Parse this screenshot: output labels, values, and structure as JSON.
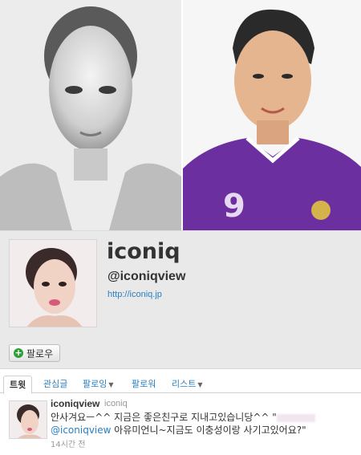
{
  "profile": {
    "name": "iconiq",
    "handle": "@iconiqview",
    "url": "http://iconiq.jp"
  },
  "follow": {
    "label": "팔로우"
  },
  "tabs": [
    {
      "label": "트윗",
      "active": true
    },
    {
      "label": "관심글",
      "active": false
    },
    {
      "label": "팔로잉",
      "active": false,
      "dropdown": true
    },
    {
      "label": "팔로워",
      "active": false
    },
    {
      "label": "리스트",
      "active": false,
      "dropdown": true
    }
  ],
  "tweet": {
    "name": "iconiqview",
    "screen_name": "iconiq",
    "line1": "안사겨요ㅡ^^ 지금은 좋은친구로 지내고있습니당^^ \"",
    "mention": "@iconiqview",
    "line2": " 아유미언니~지금도 이충성이랑 사기고있어요?\"",
    "time": "14시간 전"
  },
  "colors": {
    "link": "#2a7fc1",
    "header_bg": "#e9e9e9",
    "follow_green": "#2f9e3a",
    "jersey_purple": "#6b2fa0"
  }
}
